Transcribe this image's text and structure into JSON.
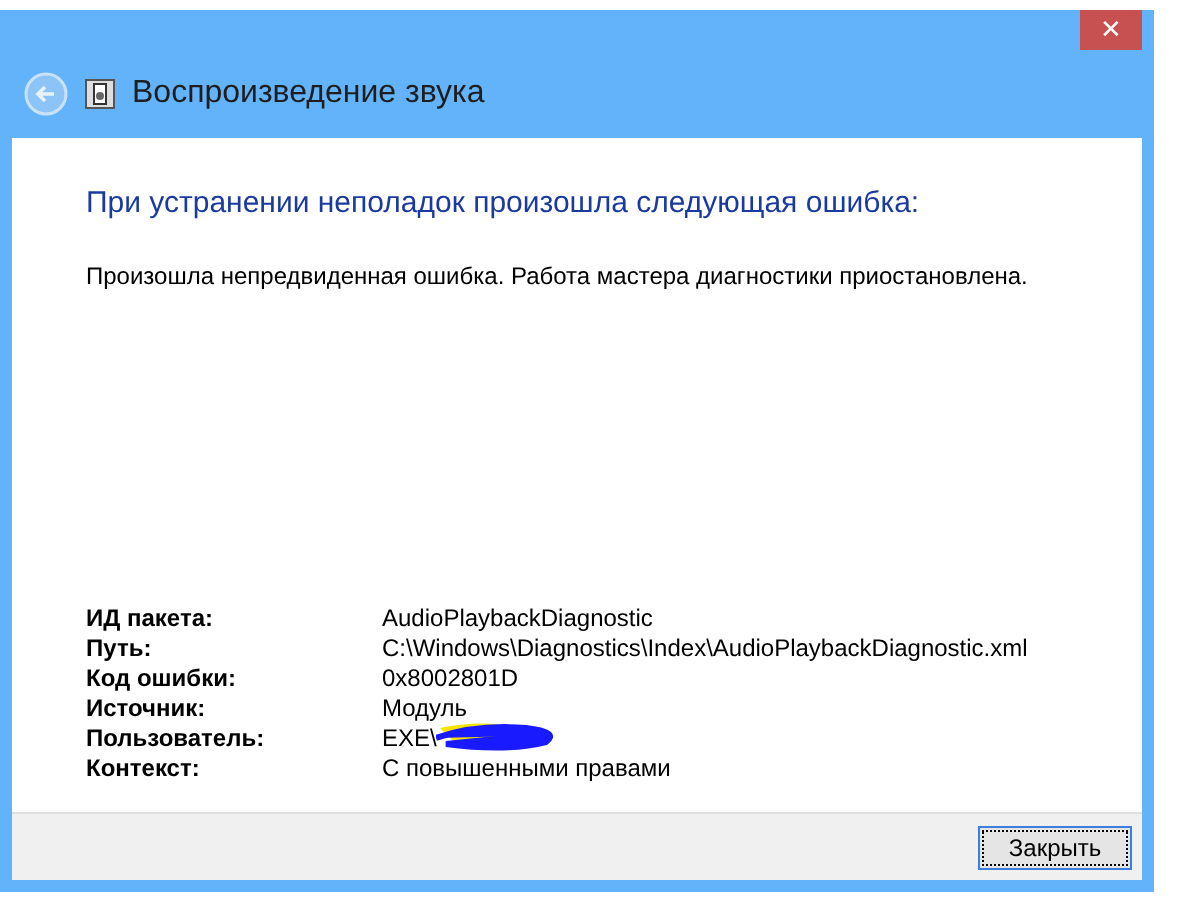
{
  "window": {
    "title": "Воспроизведение звука",
    "close": "✕"
  },
  "heading": "При устранении неполадок произошла следующая ошибка:",
  "message": "Произошла непредвиденная ошибка. Работа мастера диагностики приостановлена.",
  "details": [
    {
      "label": "ИД пакета:",
      "value": "AudioPlaybackDiagnostic",
      "redacted": false
    },
    {
      "label": "Путь:",
      "value": "C:\\Windows\\Diagnostics\\Index\\AudioPlaybackDiagnostic.xml",
      "redacted": false
    },
    {
      "label": "Код ошибки:",
      "value": "0x8002801D",
      "redacted": false
    },
    {
      "label": "Источник:",
      "value": "Модуль",
      "redacted": false
    },
    {
      "label": "Пользователь:",
      "value": "EXE\\",
      "redacted": true
    },
    {
      "label": "Контекст:",
      "value": "С повышенными правами",
      "redacted": false
    }
  ],
  "buttons": [
    {
      "label": "Закрыть",
      "focused": true
    }
  ]
}
